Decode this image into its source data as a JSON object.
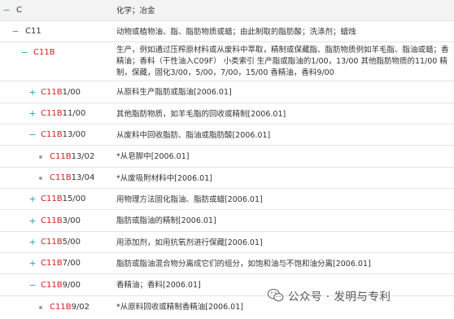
{
  "rows": [
    {
      "prefix": "",
      "suffix": "C",
      "toggle": "−",
      "desc": "化学；冶金"
    },
    {
      "prefix": "",
      "suffix": "C11",
      "toggle": "−",
      "desc": "动物或植物油、脂、脂肪物质或蜡；由此制取的脂肪酸；洗涤剂；蜡烛"
    },
    {
      "prefix": "C11B",
      "suffix": "",
      "toggle": "−",
      "desc": "生产，例如通过压榨原材料或从废料中萃取，精制或保藏脂、脂肪物质例如羊毛脂、脂油或蜡；香精油；香料（干性油入C09F） 小类索引 生产脂或脂油的1/00，13/00 其他脂肪物质的11/00 精制，保藏，固化3/00，5/00，7/00，15/00 香精油，香料9/00"
    },
    {
      "prefix": "C11B",
      "suffix": "1/00",
      "toggle": "+",
      "desc": "从原料生产脂肪或脂油[2006.01]"
    },
    {
      "prefix": "C11B",
      "suffix": "11/00",
      "toggle": "+",
      "desc": "其他脂肪物质，如羊毛脂的回收或精制[2006.01]"
    },
    {
      "prefix": "C11B",
      "suffix": "13/00",
      "toggle": "−",
      "desc": "从废料中回收脂肪、脂油或脂肪酸[2006.01]"
    },
    {
      "prefix": "C11B",
      "suffix": "13/02",
      "toggle": "•",
      "desc": "*从皂脚中[2006.01]"
    },
    {
      "prefix": "C11B",
      "suffix": "13/04",
      "toggle": "•",
      "desc": "*从废吸附材料中[2006.01]"
    },
    {
      "prefix": "C11B",
      "suffix": "15/00",
      "toggle": "+",
      "desc": "用物理方法固化脂油、脂肪或蜡[2006.01]"
    },
    {
      "prefix": "C11B",
      "suffix": "3/00",
      "toggle": "+",
      "desc": "脂肪或脂油的精制[2006.01]"
    },
    {
      "prefix": "C11B",
      "suffix": "5/00",
      "toggle": "+",
      "desc": "用添加剂，如用抗氧剂进行保藏[2006.01]"
    },
    {
      "prefix": "C11B",
      "suffix": "7/00",
      "toggle": "+",
      "desc": "脂肪或脂油混合物分离成它们的组分，如饱和油与不饱和油分离[2006.01]"
    },
    {
      "prefix": "C11B",
      "suffix": "9/00",
      "toggle": "−",
      "desc": "香精油；香料[2006.01]"
    },
    {
      "prefix": "C11B",
      "suffix": "9/02",
      "toggle": "•",
      "desc": "*从原料回收或精制香精油[2006.01]"
    }
  ],
  "watermark": {
    "text": "公众号 · 发明与专利",
    "icon": "wechat-icon"
  }
}
